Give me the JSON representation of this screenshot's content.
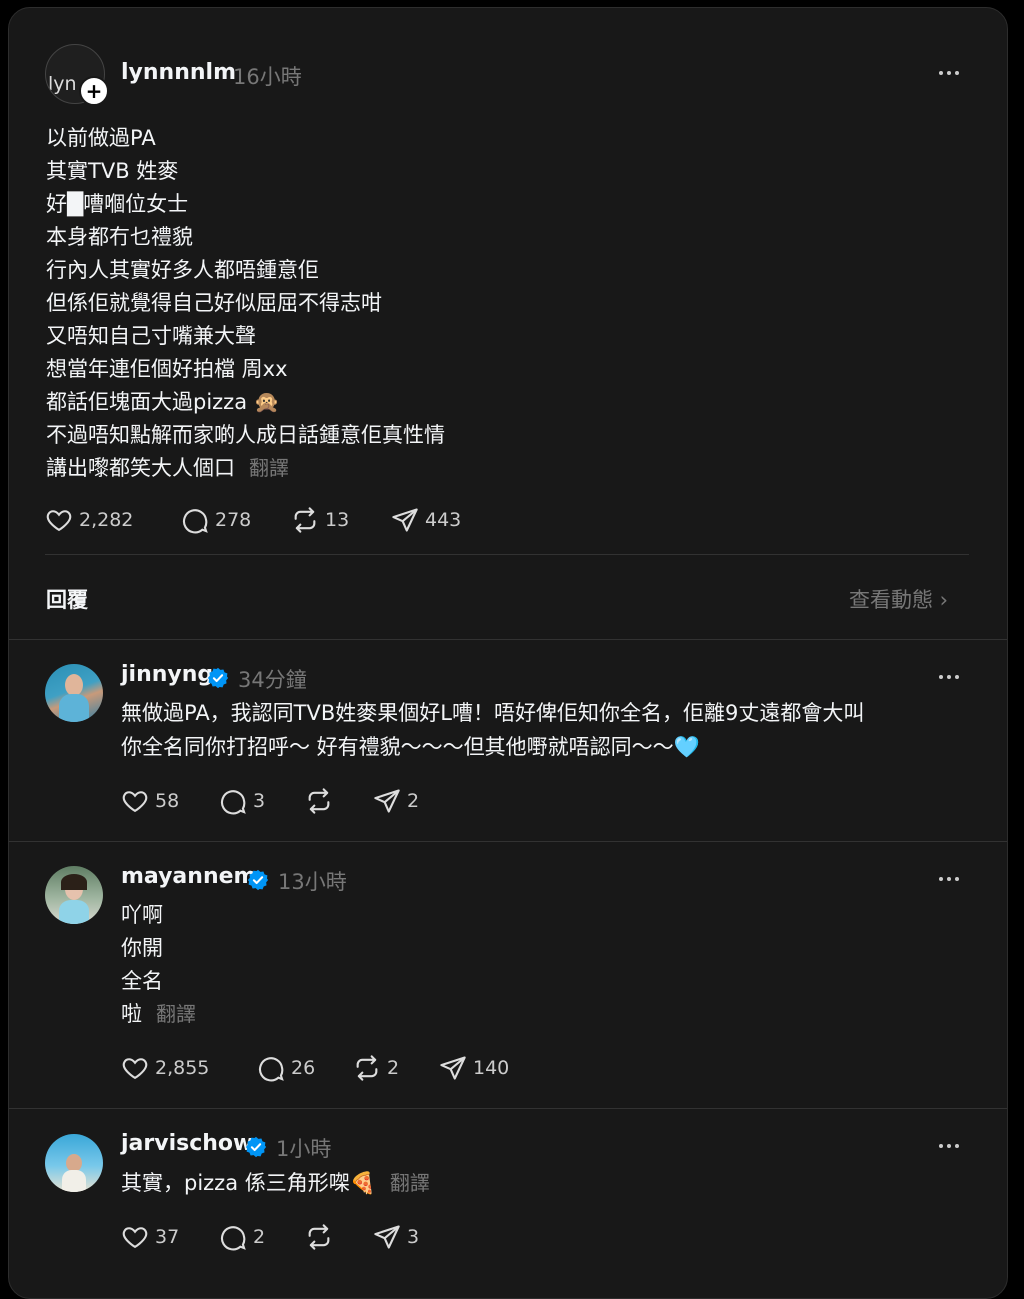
{
  "main_post": {
    "username": "lynnnnlm",
    "time": "16小時",
    "avatar_text": "lyn",
    "lines": [
      "以前做過PA",
      "其實TVB 姓麥",
      "好█嘈嗰位女士",
      "本身都冇乜禮貌",
      "行內人其實好多人都唔鍾意佢",
      "但係佢就覺得自己好似屈屈不得志咁",
      "又唔知自己寸嘴兼大聲",
      "想當年連佢個好拍檔 周xx",
      "都話佢塊面大過pizza 🙊",
      "不過唔知點解而家啲人成日話鍾意佢真性情",
      "講出嚟都笑大人個口"
    ],
    "translate": "翻譯",
    "likes": "2,282",
    "comments": "278",
    "reposts": "13",
    "shares": "443"
  },
  "replies_header": {
    "label": "回覆",
    "activity_link": "查看動態 ›"
  },
  "replies": [
    {
      "username": "jinnyng",
      "time": "34分鐘",
      "lines": [
        "無做過PA，我認同TVB姓麥果個好L嘈！唔好俾佢知你全名，佢離9丈遠都會大叫",
        "你全名同你打招呼～ 好有禮貌～～～但其他嘢就唔認同～～🩵"
      ],
      "translate": "",
      "likes": "58",
      "comments": "3",
      "reposts": "",
      "shares": "2"
    },
    {
      "username": "mayannem",
      "time": "13小時",
      "lines": [
        "吖啊",
        "你開",
        "全名",
        "啦"
      ],
      "translate": "翻譯",
      "likes": "2,855",
      "comments": "26",
      "reposts": "2",
      "shares": "140"
    },
    {
      "username": "jarvischow",
      "time": "1小時",
      "lines": [
        "其實，pizza 係三角形㗎🍕"
      ],
      "translate": "翻譯",
      "likes": "37",
      "comments": "2",
      "reposts": "",
      "shares": "3"
    }
  ],
  "colors": {
    "background": "#181818",
    "text": "#f3f5f7",
    "muted": "#777777",
    "verified": "#0095f6"
  }
}
